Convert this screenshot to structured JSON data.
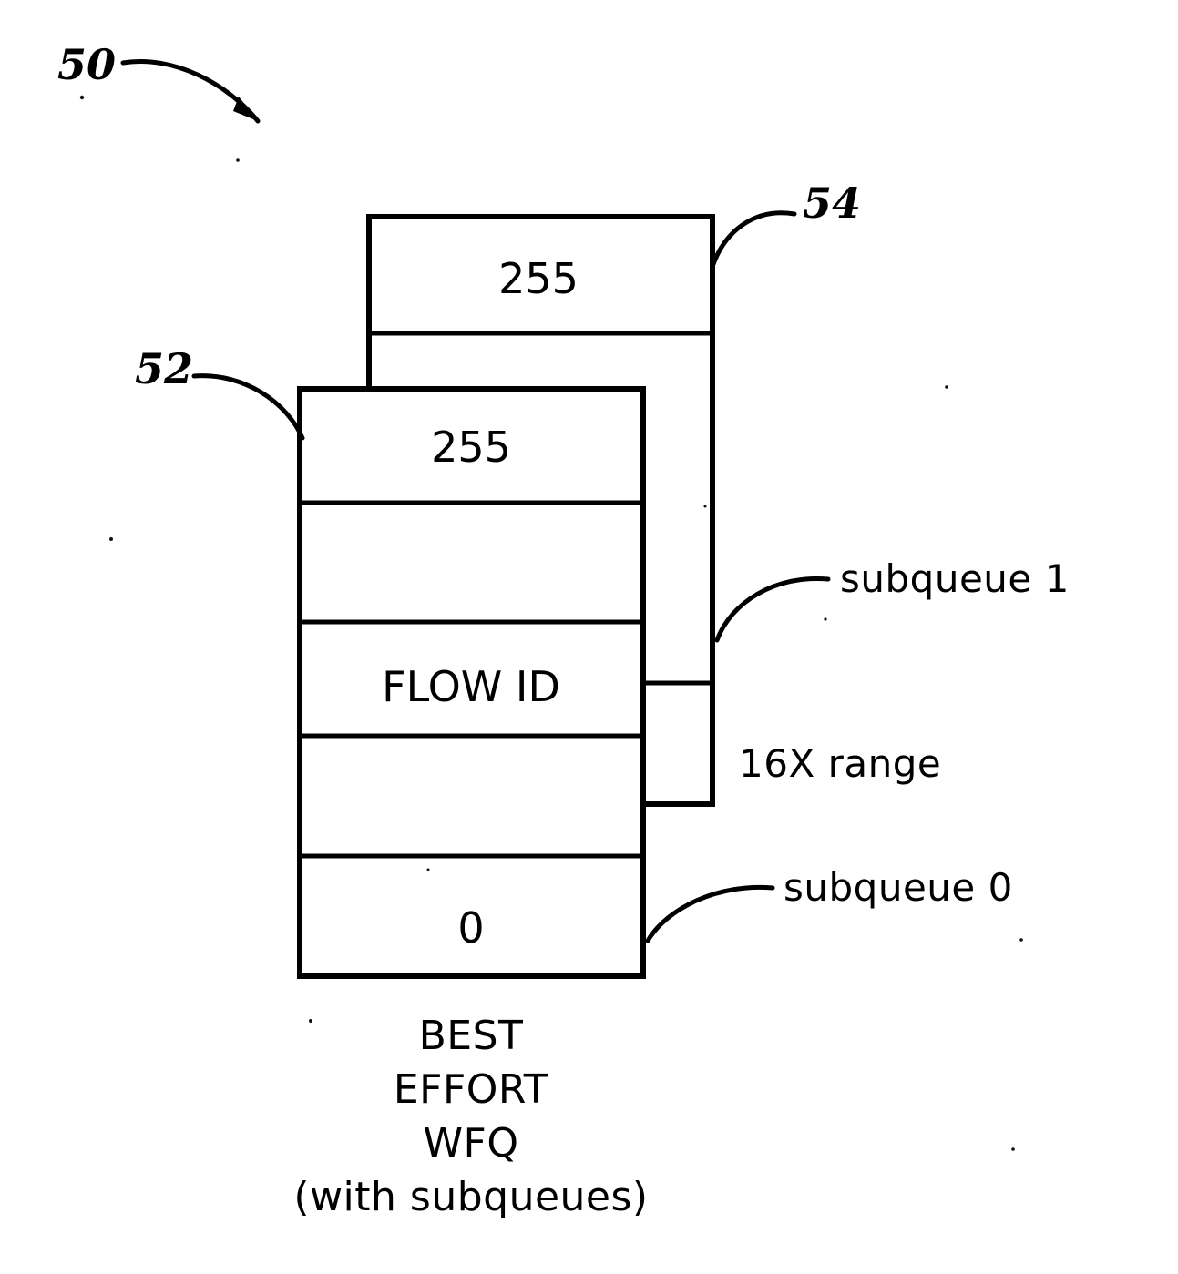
{
  "figure": {
    "reference_numerals": [
      {
        "id": "50",
        "label": "50",
        "target": "overall-figure"
      },
      {
        "id": "52",
        "label": "52",
        "target": "front-queue-box"
      },
      {
        "id": "54",
        "label": "54",
        "target": "back-queue-box"
      }
    ],
    "back_queue": {
      "name": "subqueue-1-queue",
      "cells": [
        {
          "value": "255"
        },
        {
          "value": ""
        },
        {
          "value": ""
        }
      ]
    },
    "front_queue": {
      "name": "subqueue-0-queue",
      "cells": [
        {
          "value": "255"
        },
        {
          "value": ""
        },
        {
          "value": "FLOW ID"
        },
        {
          "value": ""
        },
        {
          "value": "0"
        }
      ]
    },
    "annotations": [
      {
        "id": "subqueue-1",
        "text": "subqueue 1"
      },
      {
        "id": "range",
        "text": "16X range"
      },
      {
        "id": "subqueue-0",
        "text": "subqueue 0"
      }
    ],
    "caption": {
      "lines": [
        "BEST",
        "EFFORT",
        "WFQ",
        "(with subqueues)"
      ]
    },
    "colors": {
      "ink": "#000000",
      "paper": "#ffffff"
    }
  }
}
